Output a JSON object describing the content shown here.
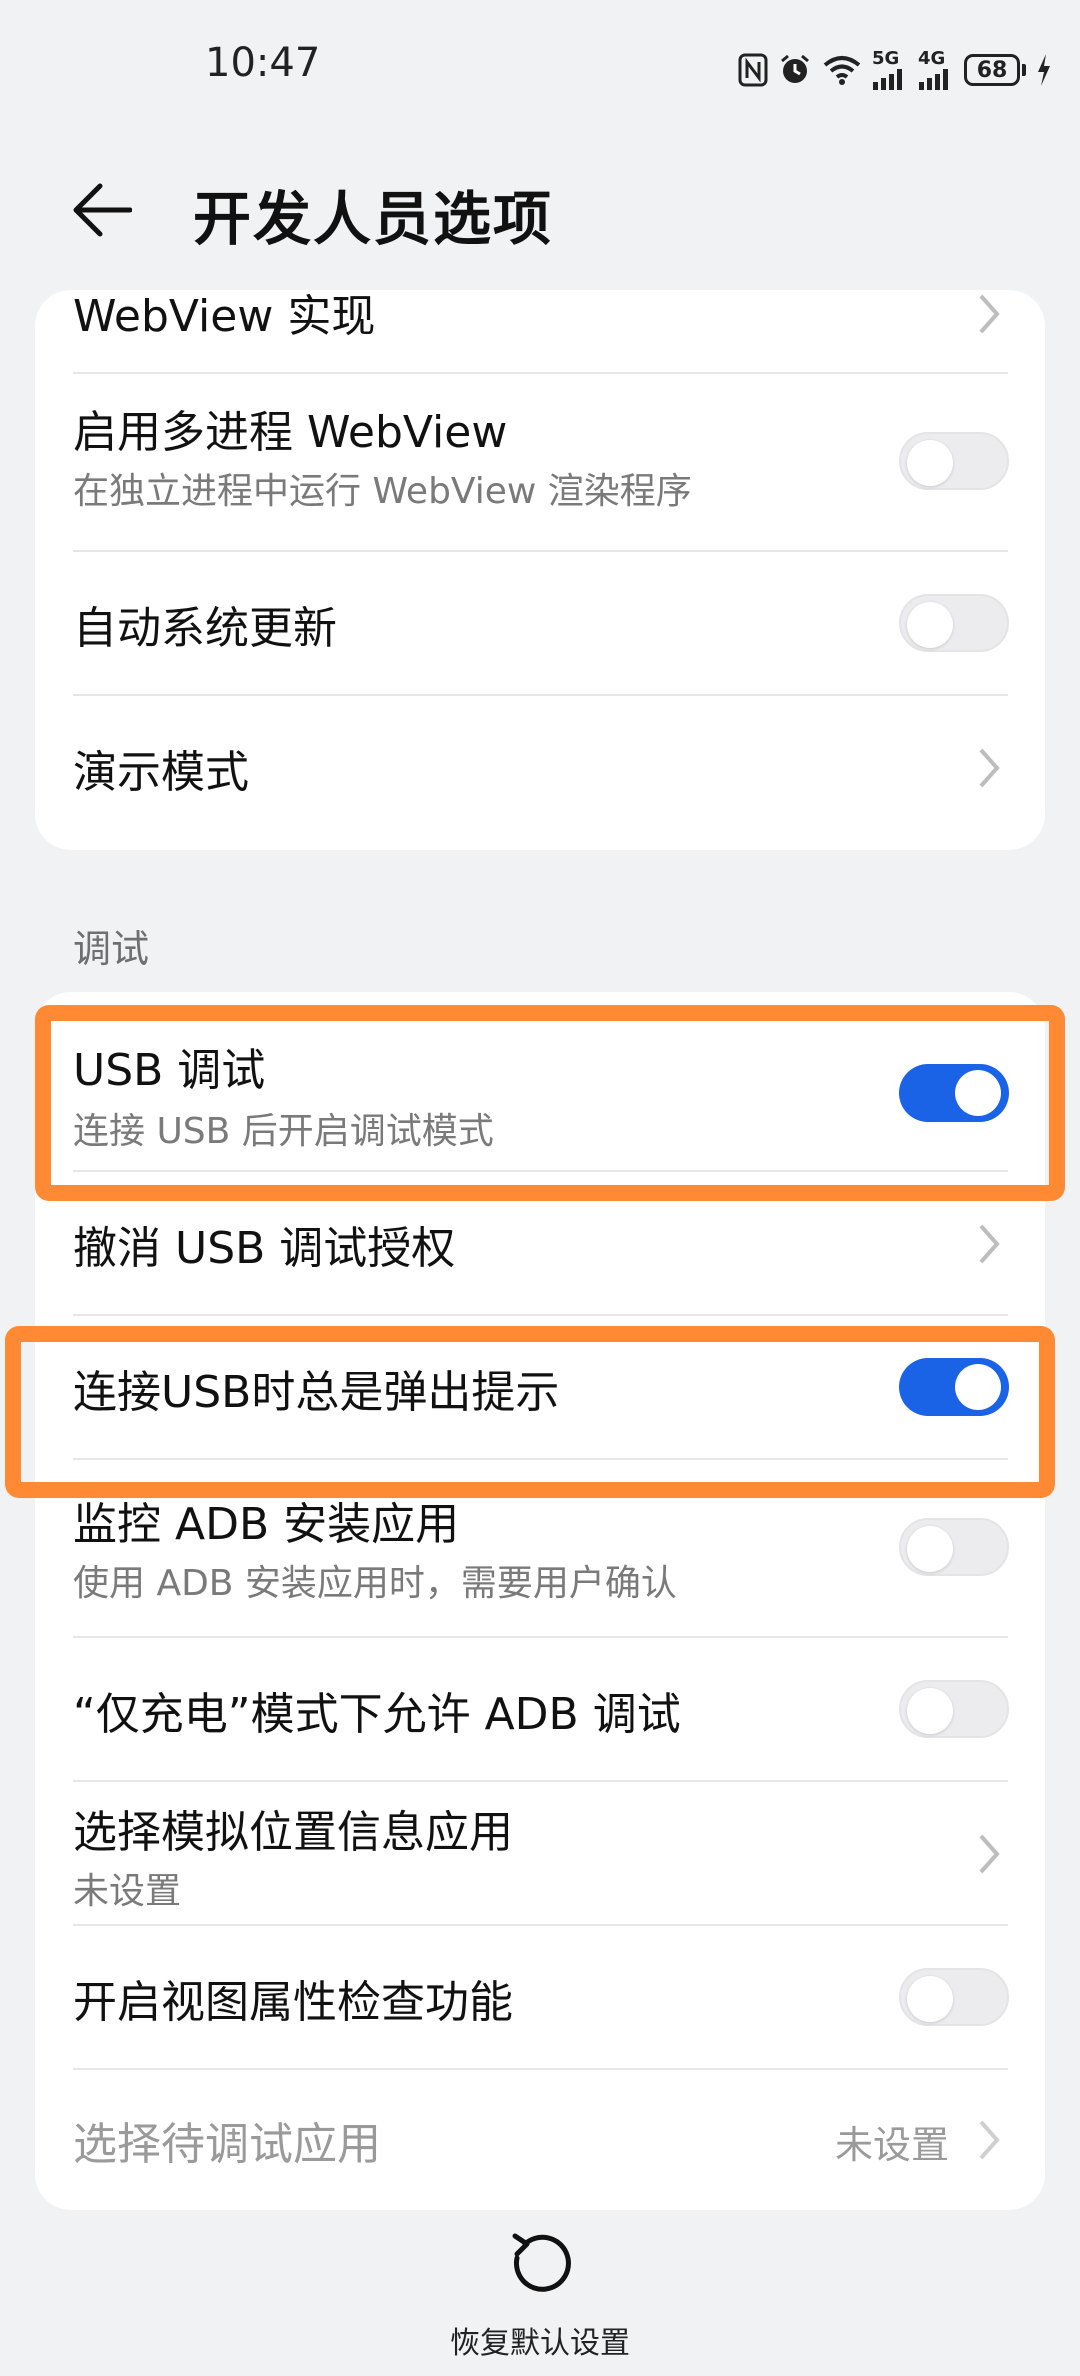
{
  "status_bar": {
    "time": "10:47",
    "network_5g": "5G",
    "network_4g": "4G",
    "battery": "68"
  },
  "header": {
    "title": "开发人员选项"
  },
  "top_card": {
    "partial_item": "WebView 实现",
    "items": [
      {
        "title": "启用多进程 WebView",
        "subtitle": "在独立进程中运行 WebView 渲染程序",
        "toggle": "off"
      },
      {
        "title": "自动系统更新",
        "toggle": "off"
      },
      {
        "title": "演示模式",
        "control": "chevron"
      }
    ]
  },
  "debug_section": {
    "label": "调试",
    "items": [
      {
        "title": "USB 调试",
        "subtitle": "连接 USB 后开启调试模式",
        "toggle": "on"
      },
      {
        "title": "撤消 USB 调试授权",
        "control": "chevron"
      },
      {
        "title": "连接USB时总是弹出提示",
        "toggle": "on"
      },
      {
        "title": "监控 ADB 安装应用",
        "subtitle": "使用 ADB 安装应用时，需要用户确认",
        "toggle": "off"
      },
      {
        "title": "“仅充电”模式下允许 ADB 调试",
        "toggle": "off"
      },
      {
        "title": "选择模拟位置信息应用",
        "subtitle": "未设置",
        "control": "chevron"
      },
      {
        "title": "开启视图属性检查功能",
        "toggle": "off"
      },
      {
        "title": "选择待调试应用",
        "value": "未设置",
        "control": "chevron",
        "state": "disabled"
      }
    ]
  },
  "footer": {
    "restore_label": "恢复默认设置"
  },
  "colors": {
    "accent": "#1b63e6",
    "highlight": "#ff8a33",
    "background": "#f1f2f4"
  }
}
